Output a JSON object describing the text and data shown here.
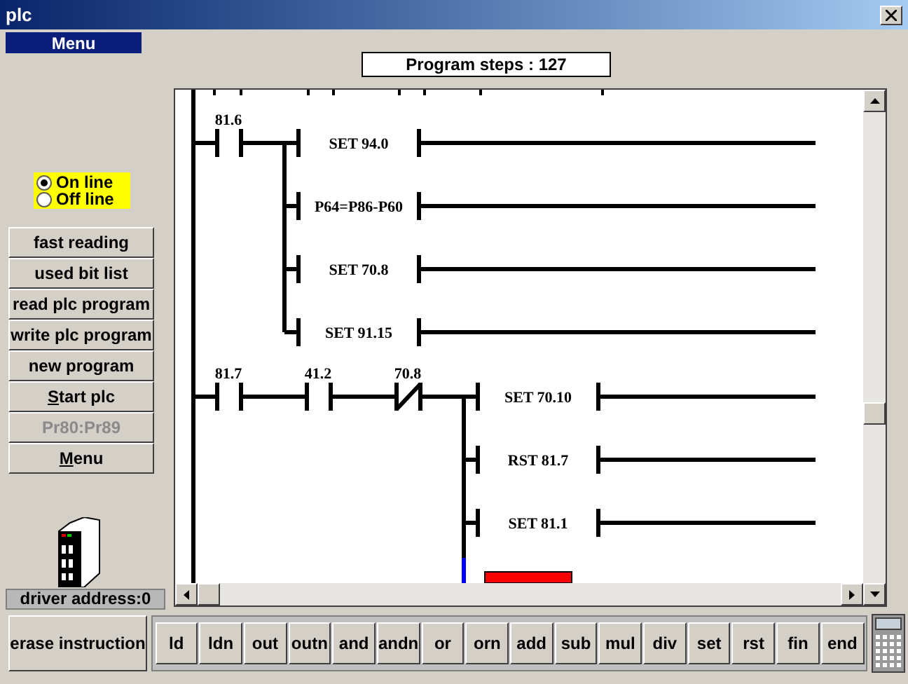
{
  "window": {
    "title": "plc"
  },
  "menu_bar": {
    "label": "Menu"
  },
  "program_steps": "Program steps : 127",
  "mode_options": [
    {
      "label": "On line",
      "selected": true
    },
    {
      "label": "Off line",
      "selected": false
    }
  ],
  "side_buttons": [
    {
      "rest": "fast reading",
      "disabled": false
    },
    {
      "rest": "used bit list",
      "disabled": false
    },
    {
      "rest": "read plc program",
      "disabled": false
    },
    {
      "rest": "write plc program",
      "disabled": false
    },
    {
      "rest": "new program",
      "disabled": false
    },
    {
      "mnemonic": "S",
      "rest": "tart plc",
      "disabled": false
    },
    {
      "rest": "Pr80:Pr89",
      "disabled": true
    },
    {
      "mnemonic": "M",
      "rest": "enu",
      "disabled": false
    }
  ],
  "driver_address": "driver address:0",
  "ladder": {
    "rungs": [
      {
        "contacts": [
          {
            "label": "81.6",
            "kind": "open"
          }
        ],
        "outputs": [
          "SET 94.0",
          "P64=P86-P60",
          "SET 70.8",
          "SET 91.15"
        ]
      },
      {
        "contacts": [
          {
            "label": "81.7",
            "kind": "open"
          },
          {
            "label": "41.2",
            "kind": "open"
          },
          {
            "label": "70.8",
            "kind": "closed"
          }
        ],
        "outputs": [
          "SET 70.10",
          "RST 81.7",
          "SET 81.1"
        ]
      }
    ]
  },
  "erase_button": "erase instruction",
  "instructions": [
    "ld",
    "ldn",
    "out",
    "outn",
    "and",
    "andn",
    "or",
    "orn",
    "add",
    "sub",
    "mul",
    "div",
    "set",
    "rst",
    "fin",
    "end"
  ]
}
